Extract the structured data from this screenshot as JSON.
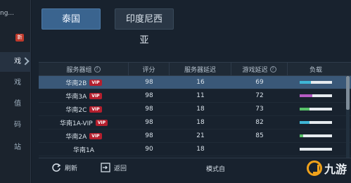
{
  "sidebar": {
    "brand": "ng...",
    "badge": "新",
    "items": [
      {
        "label": "戏",
        "active": true
      },
      {
        "label": "戏",
        "active": false
      },
      {
        "label": "值",
        "active": false
      },
      {
        "label": "码",
        "active": false
      },
      {
        "label": "站",
        "active": false
      }
    ]
  },
  "region_tabs": [
    {
      "label": "泰国",
      "selected": true
    },
    {
      "label": "印度尼西亚",
      "selected": false
    }
  ],
  "table": {
    "headers": [
      "服务器组",
      "评分",
      "服务器延迟",
      "游戏延迟",
      "负载"
    ],
    "rows": [
      {
        "name": "华南2B",
        "vip": "VIP",
        "score": "98",
        "server_delay": "16",
        "game_delay": "69",
        "load": 0.35,
        "load_color": "#3fb6d6",
        "selected": true
      },
      {
        "name": "华南3A",
        "vip": "VIP",
        "score": "98",
        "server_delay": "11",
        "game_delay": "72",
        "load": 0.4,
        "load_color": "#b65cc4",
        "selected": false
      },
      {
        "name": "华南2C",
        "vip": "VIP",
        "score": "98",
        "server_delay": "18",
        "game_delay": "73",
        "load": 0.3,
        "load_color": "#59c26a",
        "selected": false
      },
      {
        "name": "华南1A-VIP",
        "vip": "VIP",
        "score": "98",
        "server_delay": "18",
        "game_delay": "82",
        "load": 0.3,
        "load_color": "#3fb6d6",
        "selected": false
      },
      {
        "name": "华南2A",
        "vip": "VIP",
        "score": "98",
        "server_delay": "21",
        "game_delay": "85",
        "load": 0.1,
        "load_color": "#59c26a",
        "selected": false
      },
      {
        "name": "华南1A",
        "vip": "",
        "score": "90",
        "server_delay": "18",
        "game_delay": "",
        "load": 0,
        "load_color": "#3fb6d6",
        "selected": false
      }
    ]
  },
  "footer": {
    "refresh_label": "刷新",
    "back_label": "返回",
    "mode_label": "模式自"
  },
  "watermark": "九游",
  "colors": {
    "accent": "#3a648f",
    "vip": "#b51f2e"
  }
}
